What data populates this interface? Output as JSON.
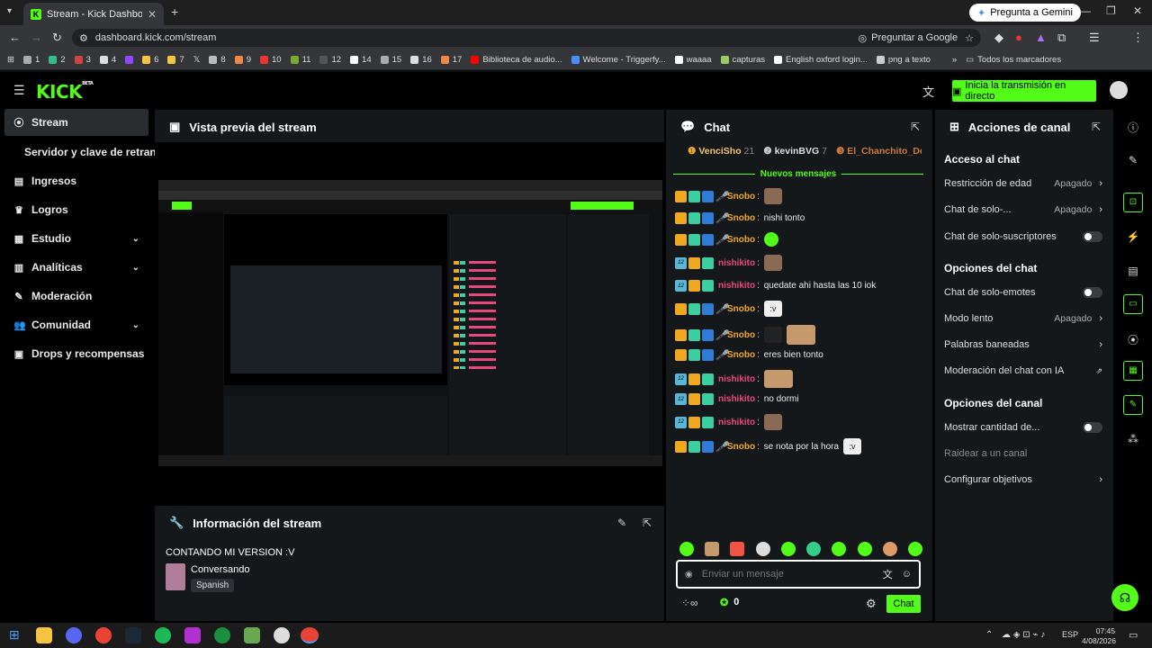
{
  "browser": {
    "tab_title": "Stream - Kick Dashboard",
    "ask_gemini": "Pregunta a Gemini",
    "url": "dashboard.kick.com/stream",
    "ask_google": "Preguntar a Google",
    "bookmarks": [
      "1",
      "2",
      "3",
      "4",
      "",
      "6",
      "7",
      "",
      "8",
      "9",
      "10",
      "11",
      "12",
      "14",
      "15",
      "16",
      "17",
      "Biblioteca de audio...",
      "Welcome - Triggerfy...",
      "waaaa",
      "capturas",
      "English oxford login...",
      "png a texto"
    ],
    "all_bookmarks": "Todos los marcadores"
  },
  "header": {
    "logo": "KICK",
    "logo_beta": "BETA",
    "go_live": "Inicia la transmisión en directo"
  },
  "sidebar": {
    "items": [
      {
        "label": "Stream"
      },
      {
        "label": "Servidor y clave de retransm"
      },
      {
        "label": "Ingresos"
      },
      {
        "label": "Logros"
      },
      {
        "label": "Estudio"
      },
      {
        "label": "Analíticas"
      },
      {
        "label": "Moderación"
      },
      {
        "label": "Comunidad"
      },
      {
        "label": "Drops y recompensas"
      }
    ]
  },
  "preview": {
    "title": "Vista previa del stream"
  },
  "info": {
    "title": "Información del stream",
    "stream_title": "CONTANDO MI VERSION :V",
    "category": "Conversando",
    "language": "Spanish"
  },
  "chat": {
    "title": "Chat",
    "top": [
      {
        "name": "VenciSho",
        "count": "21"
      },
      {
        "name": "kevinBVG",
        "count": "7"
      },
      {
        "name": "El_Chanchito_De_D",
        "count": ""
      }
    ],
    "new_messages": "Nuevos mensajes",
    "messages": [
      {
        "user": "Snobo",
        "text": ""
      },
      {
        "user": "Snobo",
        "text": "nishi tonto"
      },
      {
        "user": "Snobo",
        "text": ""
      },
      {
        "user": "nishikito",
        "text": ""
      },
      {
        "user": "nishikito",
        "text": "quedate ahi hasta las 10 iok"
      },
      {
        "user": "Snobo",
        "text": ""
      },
      {
        "user": "Snobo",
        "text": ""
      },
      {
        "user": "Snobo",
        "text": "eres bien tonto"
      },
      {
        "user": "nishikito",
        "text": ""
      },
      {
        "user": "nishikito",
        "text": "no dormi"
      },
      {
        "user": "nishikito",
        "text": ""
      },
      {
        "user": "Snobo",
        "text": "se nota por la hora"
      }
    ],
    "emote_text_v": ":v",
    "input_placeholder": "Enviar un mensaje",
    "kicks": "0",
    "send": "Chat"
  },
  "actions": {
    "title": "Acciones de canal",
    "access_title": "Acceso al chat",
    "age": "Restricción de edad",
    "age_val": "Apagado",
    "solo": "Chat de solo-...",
    "solo_val": "Apagado",
    "subs": "Chat de solo-suscriptores",
    "chat_opts": "Opciones del chat",
    "emotes": "Chat de solo-emotes",
    "slow": "Modo lento",
    "slow_val": "Apagado",
    "banned": "Palabras baneadas",
    "ai_mod": "Moderación del chat con IA",
    "channel_opts": "Opciones del canal",
    "show_count": "Mostrar cantidad de...",
    "raid": "Raidear a un canal",
    "goals": "Configurar objetivos"
  },
  "taskbar": {
    "lang": "ESP",
    "time": "07:45",
    "date": "4/08/2026"
  }
}
